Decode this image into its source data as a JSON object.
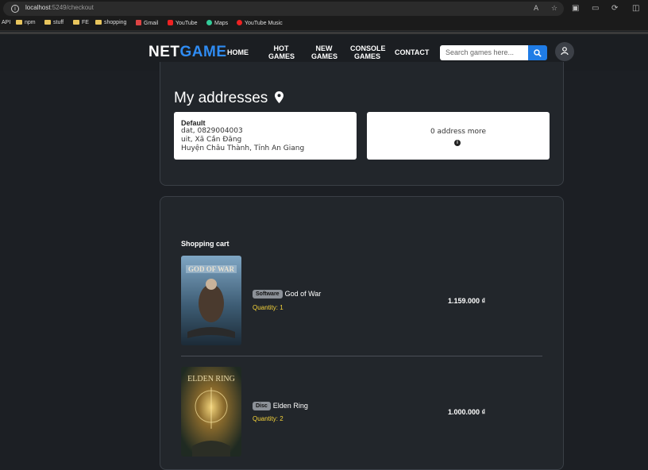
{
  "browser": {
    "url_host": "localhost",
    "url_path": ":5249/checkout",
    "bookmarks": [
      {
        "label": "API",
        "kind": "text"
      },
      {
        "label": "npm",
        "kind": "folder"
      },
      {
        "label": "stuff",
        "kind": "folder"
      },
      {
        "label": "FE",
        "kind": "folder"
      },
      {
        "label": "shopping",
        "kind": "folder"
      },
      {
        "label": "Gmail",
        "kind": "gmail"
      },
      {
        "label": "YouTube",
        "kind": "youtube"
      },
      {
        "label": "Maps",
        "kind": "maps"
      },
      {
        "label": "YouTube Music",
        "kind": "ytmusic"
      }
    ]
  },
  "navbar": {
    "logo_part1": "NET",
    "logo_part2": "GAME",
    "links": [
      {
        "line1": "HOME",
        "line2": ""
      },
      {
        "line1": "HOT",
        "line2": "GAMES"
      },
      {
        "line1": "NEW",
        "line2": "GAMES"
      },
      {
        "line1": "CONSOLE",
        "line2": "GAMES"
      },
      {
        "line1": "CONTACT",
        "line2": ""
      }
    ],
    "search_placeholder": "Search games here..."
  },
  "addresses": {
    "title": "My addresses",
    "default_card": {
      "label": "Default",
      "line1": "dat, 0829004003",
      "line2": "uit, Xã Cần Đăng",
      "line3": "Huyện Châu Thành, Tỉnh An Giang"
    },
    "more_text": "0 address more"
  },
  "cart": {
    "title": "Shopping cart",
    "items": [
      {
        "badge": "Software",
        "name": "God of War",
        "quantity": "Quantity: 1",
        "price": "1.159.000 ₫",
        "cover_text": "GOD OF WAR"
      },
      {
        "badge": "Disc",
        "name": "Elden Ring",
        "quantity": "Quantity: 2",
        "price": "1.000.000 ₫",
        "cover_text": "ELDEN RING"
      }
    ]
  },
  "colors": {
    "accent": "#2f8cf3",
    "quantity": "#f5d33a",
    "background": "#1c1f24",
    "panel": "#22262b"
  }
}
